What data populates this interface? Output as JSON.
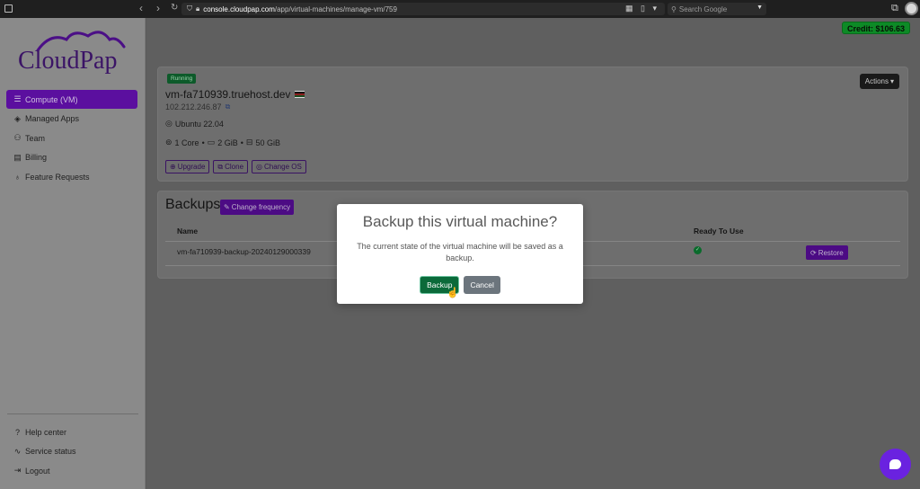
{
  "browser": {
    "url_host": "console.cloudpap.com",
    "url_path": "/app/virtual-machines/manage-vm/759",
    "search_placeholder": "Search Google"
  },
  "sidebar": {
    "logo_text": "CloudPap",
    "items": [
      {
        "label": "Compute (VM)",
        "icon": "database-icon",
        "active": true
      },
      {
        "label": "Managed Apps",
        "icon": "layers-icon"
      },
      {
        "label": "Team",
        "icon": "people-icon"
      },
      {
        "label": "Billing",
        "icon": "receipt-icon"
      },
      {
        "label": "Feature Requests",
        "icon": "lightbulb-icon"
      }
    ],
    "bottom_items": [
      {
        "label": "Help center",
        "icon": "question-icon"
      },
      {
        "label": "Service status",
        "icon": "activity-icon"
      },
      {
        "label": "Logout",
        "icon": "logout-icon"
      }
    ]
  },
  "header": {
    "credit": "Credit: $106.63"
  },
  "vm": {
    "status": "Running",
    "name": "vm-fa710939.truehost.dev",
    "ip": "102.212.246.87",
    "os": "Ubuntu 22.04",
    "cores": "1 Core",
    "ram": "2 GiB",
    "disk": "50 GiB",
    "actions_label": "Actions",
    "buttons": {
      "upgrade": "Upgrade",
      "clone": "Clone",
      "change_os": "Change OS"
    }
  },
  "backups": {
    "title": "Backups",
    "change_frequency": "Change frequency",
    "columns": {
      "name": "Name",
      "ready": "Ready To Use"
    },
    "rows": [
      {
        "name": "vm-fa710939-backup-20240129000339",
        "ready": true,
        "restore_label": "Restore"
      }
    ]
  },
  "modal": {
    "title": "Backup this virtual machine?",
    "body": "The current state of the virtual machine will be saved as a backup.",
    "confirm_label": "Backup",
    "cancel_label": "Cancel"
  },
  "colors": {
    "brand_purple": "#5b0f9f",
    "success_green": "#0b6a3a",
    "credit_green": "#0d8a26"
  }
}
